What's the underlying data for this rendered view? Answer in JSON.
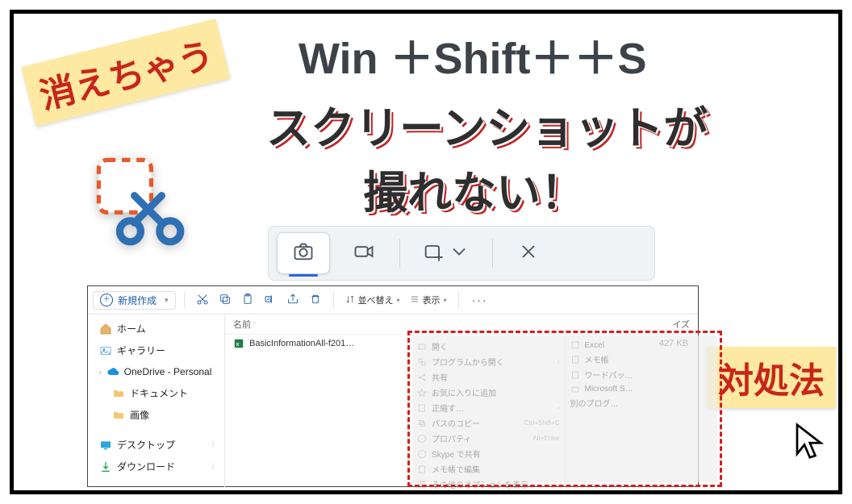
{
  "title_line1": "Win ＋Shift＋＋S",
  "title_line2": "スクリーンショットが",
  "title_line3": "撮れない！",
  "badge_disappear": "消えちゃう",
  "badge_solution": "対処法",
  "snip_toolbar": {
    "tabs": [
      {
        "icon": "camera-icon",
        "label": ""
      },
      {
        "icon": "video-icon",
        "label": ""
      }
    ]
  },
  "explorer": {
    "new_button": "新規作成",
    "menu_sort": "並べ替え",
    "menu_view": "表示",
    "col_name": "名前",
    "col_size": "イズ",
    "file": {
      "name": "BasicInformationAll-f201…",
      "size": "427 KB"
    },
    "sidebar": {
      "home": "ホーム",
      "gallery": "ギャラリー",
      "onedrive": "OneDrive - Personal",
      "documents": "ドキュメント",
      "pictures": "画像",
      "desktop": "デスクトップ",
      "downloads": "ダウンロード"
    },
    "context_menu": {
      "left": [
        {
          "label": "開く"
        },
        {
          "label": "プログラムから開く"
        },
        {
          "label": "共有"
        },
        {
          "label": "お気に入りに追加"
        },
        {
          "label": "正縮す…"
        },
        {
          "label": "パスのコピー"
        },
        {
          "label": "プロパティ",
          "sub": "Alt+Enter"
        },
        {
          "label": "Skype で共有"
        },
        {
          "label": "メモ帳で編集"
        },
        {
          "label": "その他のオプションを表示"
        }
      ],
      "right": [
        {
          "label": "Excel"
        },
        {
          "label": "メモ帳"
        },
        {
          "label": "ワードパッ…"
        },
        {
          "label": "Microsoft S…"
        },
        {
          "label": "別のプログ…"
        }
      ]
    }
  }
}
